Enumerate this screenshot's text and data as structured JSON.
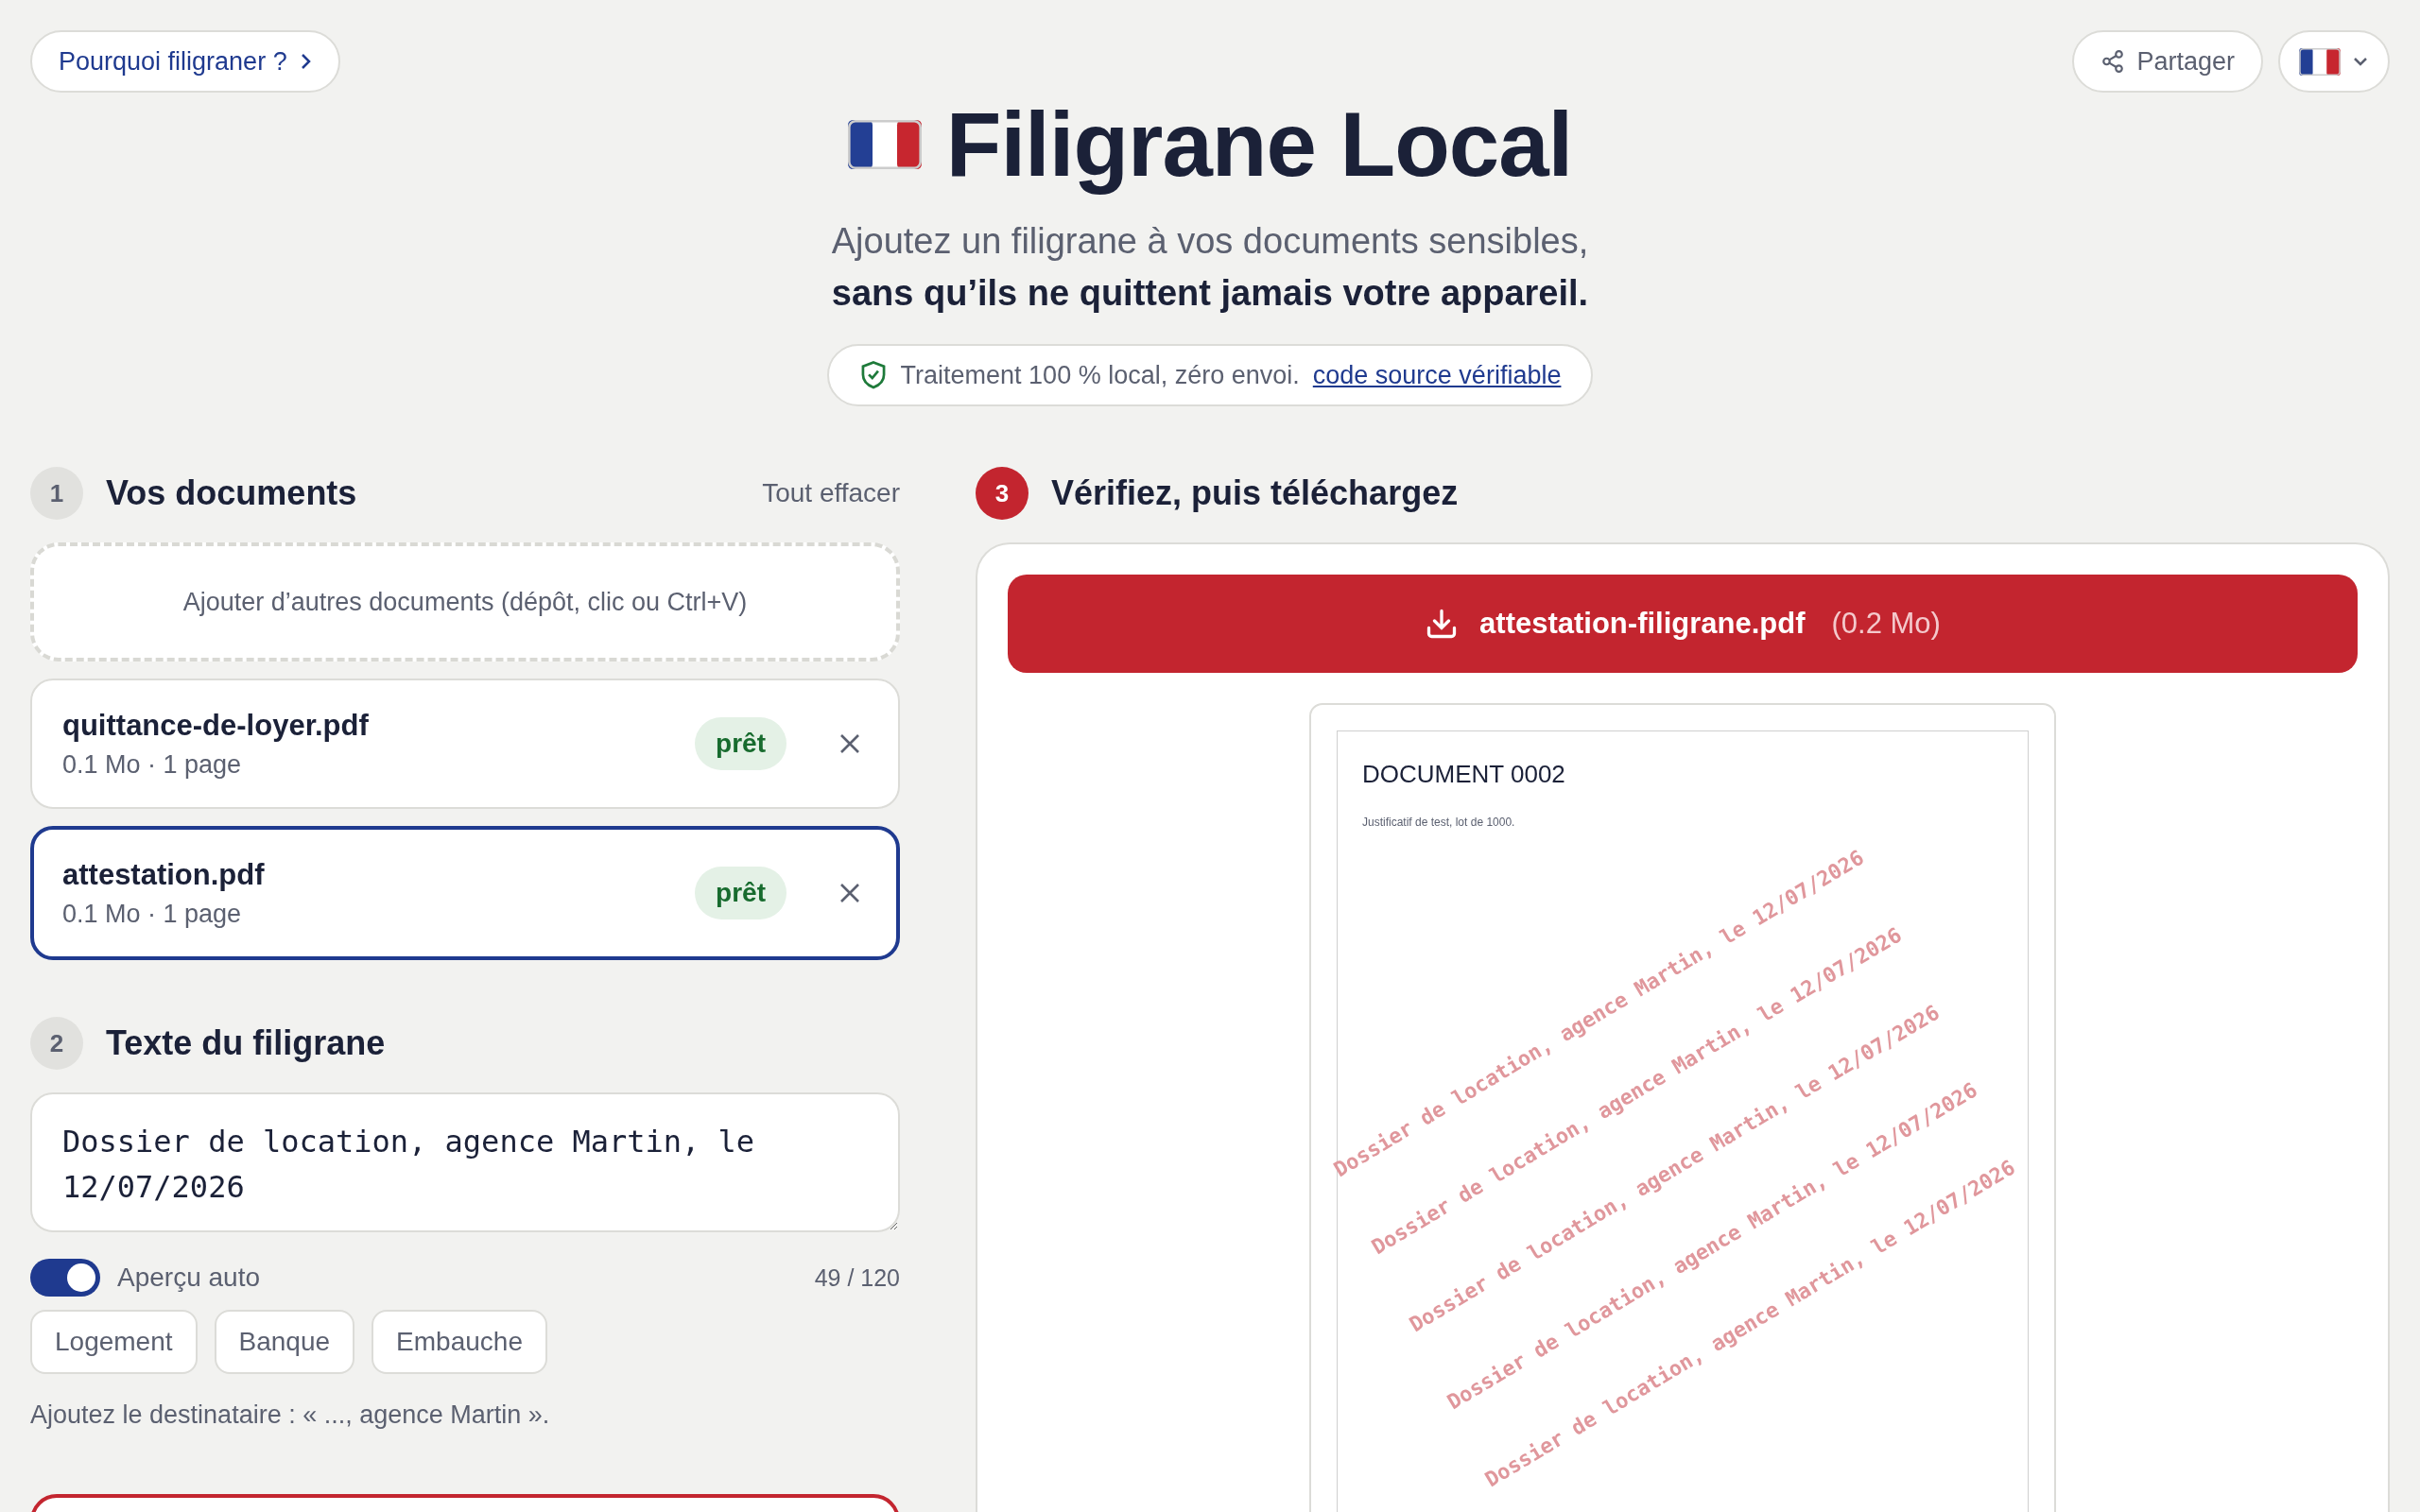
{
  "top_link": {
    "label": "Pourquoi filigraner ?"
  },
  "share_button": {
    "label": "Partager"
  },
  "title": "Filigrane Local",
  "subtitle": "Ajoutez un filigrane à vos documents sensibles,",
  "subtitle_strong": "sans qu’ils ne quittent jamais votre appareil.",
  "trust_badge": {
    "text": "Traitement 100 % local, zéro envoi.",
    "link": "code source vérifiable"
  },
  "documents_section": {
    "step": "1",
    "active": false,
    "title": "Vos documents",
    "clear_all": "Tout effacer",
    "dropzone": "Ajouter d’autres documents (dépôt, clic ou Ctrl+V)",
    "files": [
      {
        "name": "quittance-de-loyer.pdf",
        "meta": "0.1 Mo · 1 page",
        "status": "prêt",
        "selected": false
      },
      {
        "name": "attestation.pdf",
        "meta": "0.1 Mo · 1 page",
        "status": "prêt",
        "selected": true
      }
    ]
  },
  "watermark_section": {
    "step": "2",
    "active": false,
    "title": "Texte du filigrane",
    "value": "Dossier de location, agence Martin, le 12/07/2026",
    "auto_preview": {
      "label": "Aperçu auto",
      "on": true
    },
    "counter": "49 / 120",
    "presets": [
      "Logement",
      "Banque",
      "Embauche"
    ],
    "hint": "Ajoutez le destinataire : « ..., agence Martin »."
  },
  "preview_section": {
    "step": "3",
    "active": true,
    "title": "Vérifiez, puis téléchargez",
    "download": {
      "filename": "attestation-filigrane.pdf",
      "size": "(0.2 Mo)"
    },
    "document": {
      "title": "DOCUMENT 0002",
      "body": "Justificatif de test, lot de 1000.",
      "watermark_lines": [
        "Dossier de location, agence Martin, le 12/07/2026",
        "Dossier de location, agence Martin, le 12/07/2026",
        "Dossier de location, agence Martin, le 12/07/2026",
        "Dossier de location, agence Martin, le 12/07/2026",
        "Dossier de location, agence Martin, le 12/07/2026"
      ]
    }
  }
}
